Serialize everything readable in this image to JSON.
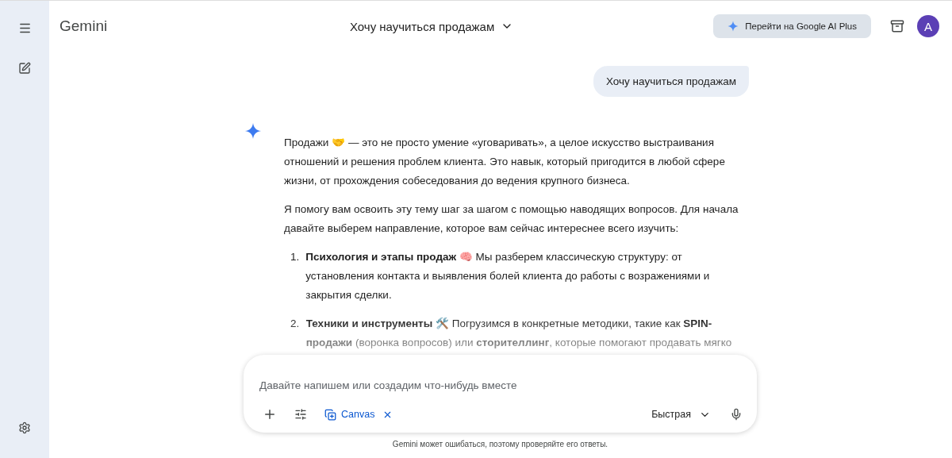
{
  "app": {
    "name": "Gemini"
  },
  "header": {
    "chat_title": "Хочу научиться продажам",
    "upgrade_button": "Перейти на Google AI Plus",
    "avatar": "A"
  },
  "user_message": "Хочу научиться продажам",
  "response": {
    "paragraphs": [
      "Продажи 🤝 — это не просто умение «уговаривать», а целое искусство выстраивания отношений и решения проблем клиента. Это навык, который пригодится в любой сфере жизни, от прохождения собеседования до ведения крупного бизнеса.",
      "Я помогу вам освоить эту тему шаг за шагом с помощью наводящих вопросов. Для начала давайте выберем направление, которое вам сейчас интереснее всего изучить:"
    ],
    "items": [
      {
        "number": "1.",
        "title": "Психология и этапы продаж 🧠",
        "text": "Мы разберем классическую структуру: от установления контакта и выявления болей клиента до работы с возражениями и закрытия сделки."
      },
      {
        "number": "2.",
        "title": "Техники и инструменты 🛠️",
        "text": "Погрузимся в конкретные методики, такие как **SPIN-продажи** (воронка вопросов) или **сторителлинг**, которые помогают продавать мягко"
      }
    ]
  },
  "composer": {
    "placeholder": "Давайте напишем или создадим что-нибудь вместе",
    "tool_chip": "Canvas",
    "model": "Быстрая"
  },
  "disclaimer": "Gemini может ошибаться, поэтому проверяйте его ответы."
}
